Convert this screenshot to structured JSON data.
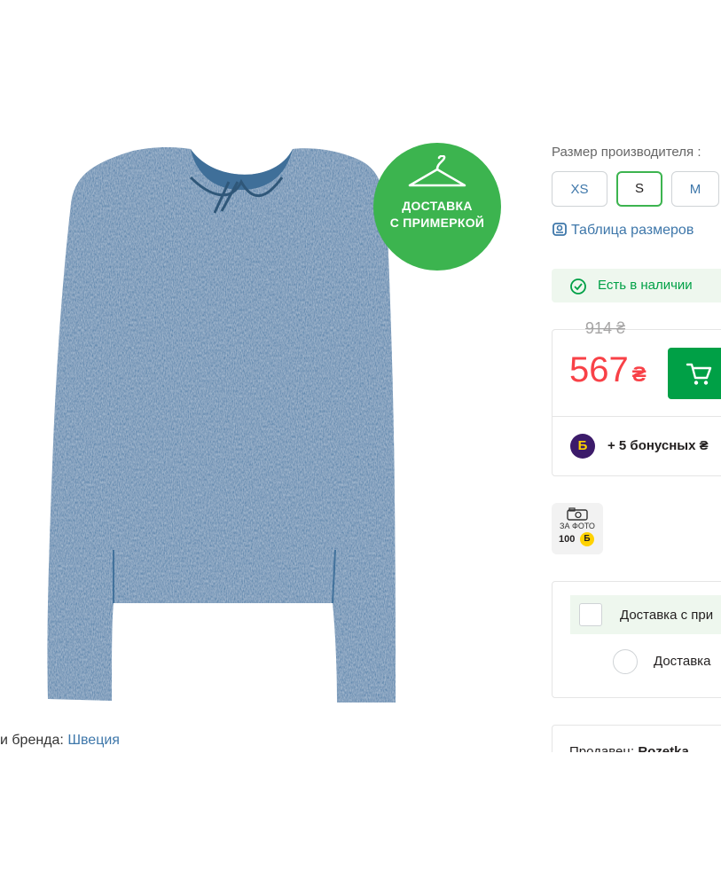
{
  "promo": {
    "line1": "ДОСТАВКА",
    "line2": "С ПРИМЕРКОЙ",
    "icon": "hanger-icon",
    "color": "#3cb44f"
  },
  "brand": {
    "label": "и бренда: ",
    "country": "Швеция"
  },
  "sizes": {
    "label": "Размер производителя :",
    "options": [
      "XS",
      "S",
      "M"
    ],
    "selected": "S",
    "table_link": "Таблица размеров"
  },
  "availability": {
    "text": "Есть в наличии",
    "color": "#00a046"
  },
  "price": {
    "old": "914 ₴",
    "current": "567",
    "currency": "₴",
    "color": "#f84147"
  },
  "cart_button": {
    "icon": "cart-icon",
    "color": "#00a046"
  },
  "bonus": {
    "icon_letter": "Б",
    "text": "+ 5 бонусных ₴"
  },
  "photo_bonus": {
    "icon": "camera-icon",
    "label": "ЗА ФОТО",
    "amount": "100",
    "letter": "Б"
  },
  "delivery": {
    "option1": "Доставка с при",
    "option2": "Доставка"
  },
  "seller": {
    "label": "Продавец: ",
    "name": "Rozetka"
  }
}
